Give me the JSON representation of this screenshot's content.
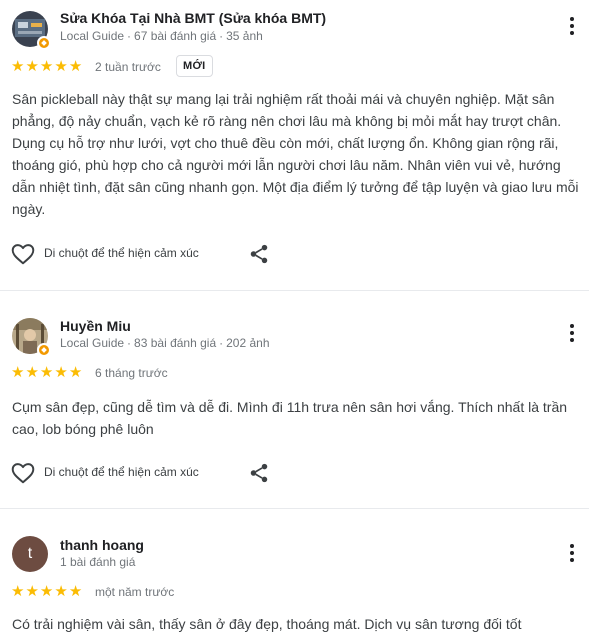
{
  "reviews": [
    {
      "name": "Sửa Khóa Tại Nhà BMT (Sửa khóa BMT)",
      "meta": {
        "guide": "Local Guide",
        "reviews": "67 bài đánh giá",
        "photos": "35 ảnh"
      },
      "rating": 5,
      "time": "2 tuần trước",
      "badge": "MỚI",
      "text": "Sân pickleball này thật sự mang lại trải nghiệm rất thoải mái và chuyên nghiệp. Mặt sân phẳng, độ nảy chuẩn, vạch kẻ rõ ràng nên chơi lâu mà không bị mỏi mắt hay trượt chân. Dụng cụ hỗ trợ như lưới, vợt cho thuê đều còn mới, chất lượng ổn. Không gian rộng rãi, thoáng gió, phù hợp cho cả người mới lẫn người chơi lâu năm. Nhân viên vui vẻ, hướng dẫn nhiệt tình, đặt sân cũng nhanh gọn. Một địa điểm lý tưởng để tập luyện và giao lưu mỗi ngày.",
      "like_label": "Di chuột để thể hiện cảm xúc"
    },
    {
      "name": "Huyền Miu",
      "meta": {
        "guide": "Local Guide",
        "reviews": "83 bài đánh giá",
        "photos": "202 ảnh"
      },
      "rating": 5,
      "time": "6 tháng trước",
      "text": "Cụm sân đẹp, cũng dễ tìm và dễ đi. Mình đi 11h trưa nên sân hơi vắng. Thích nhất là trần cao, lob bóng phê luôn",
      "like_label": "Di chuột để thể hiện cảm xúc"
    },
    {
      "name": "thanh hoang",
      "avatar_letter": "t",
      "meta": {
        "reviews": "1 bài đánh giá"
      },
      "rating": 5,
      "time": "một năm trước",
      "text": "Có trải nghiệm vài sân, thấy sân ở đây đẹp, thoáng mát. Dịch vụ sân tương đối tốt"
    }
  ],
  "colors": {
    "star": "#fbbc04",
    "secondary_text": "#70757a",
    "guide_badge": "#f29900",
    "letter_avatar": "#6d4c41"
  },
  "icons": {
    "like": "heart-outline-icon",
    "share": "share-icon",
    "menu": "more-vert-icon"
  }
}
